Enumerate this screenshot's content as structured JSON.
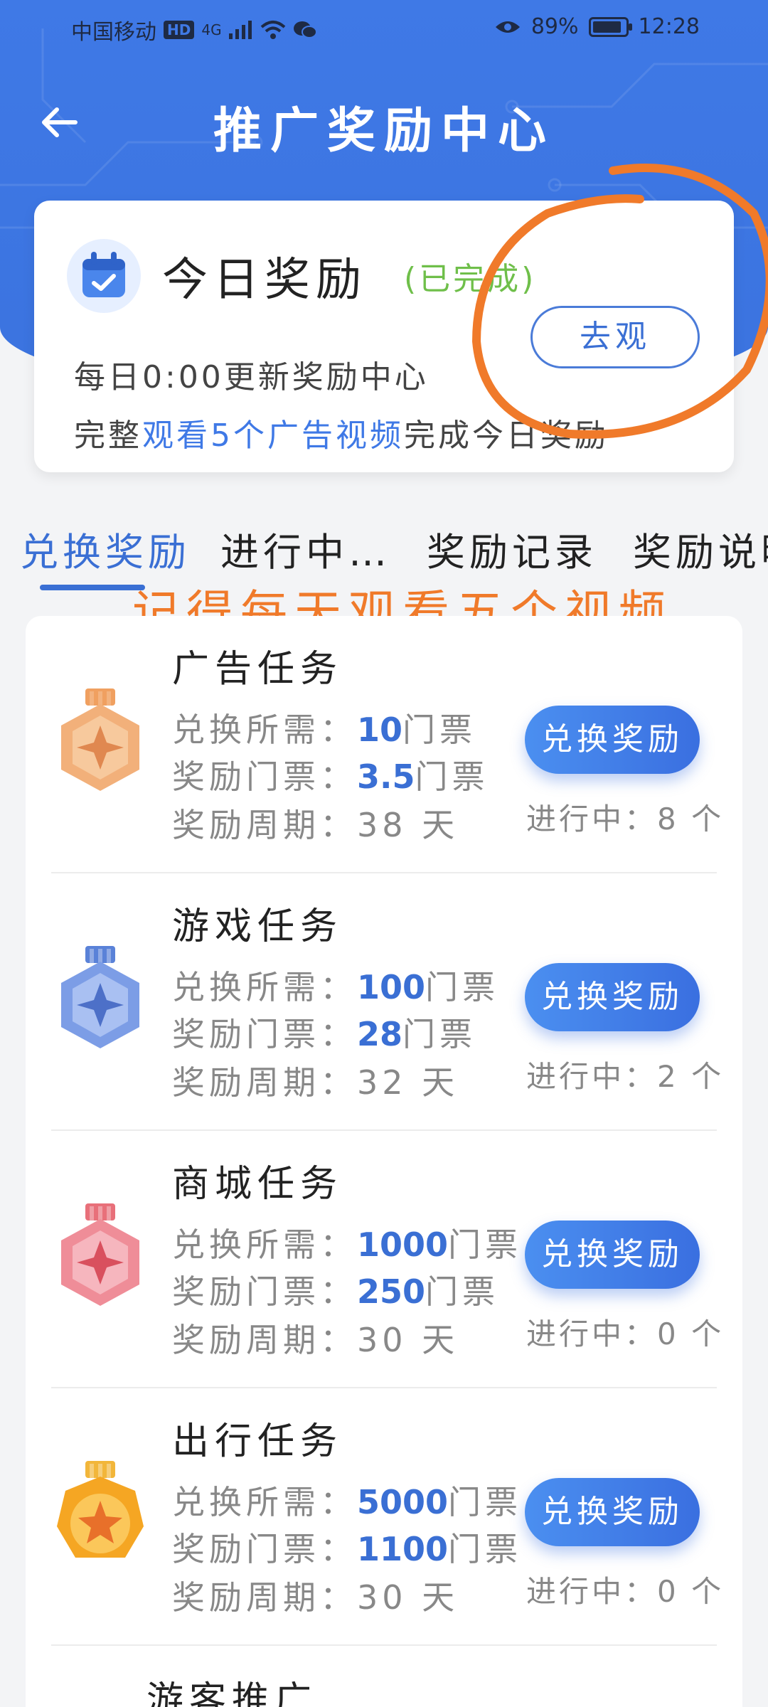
{
  "status_bar": {
    "carrier": "中国移动",
    "hd": "HD",
    "network": "4G",
    "battery_percent": "89%",
    "battery_level": 0.89,
    "time": "12:28"
  },
  "header": {
    "title": "推广奖励中心"
  },
  "today": {
    "title": "今日奖励",
    "status": "(已完成)",
    "go_button": "去观",
    "line1": "每日0:00更新奖励中心",
    "line2_prefix": "完整",
    "line2_highlight": "观看5个广告视频",
    "line2_suffix": "完成今日奖励"
  },
  "tabs": [
    {
      "label": "兑换奖励",
      "active": true
    },
    {
      "label": "进行中…",
      "active": false
    },
    {
      "label": "奖励记录",
      "active": false
    },
    {
      "label": "奖励说明",
      "active": false
    }
  ],
  "annotation": {
    "text": "记得每天观看五个视频",
    "color": "#f07a2a"
  },
  "labels": {
    "cost": "兑换所需：",
    "reward": "奖励门票：",
    "period": "奖励周期：",
    "unit_ticket": "门票",
    "unit_day": "天",
    "redeem": "兑换奖励"
  },
  "tasks": [
    {
      "title": "广告任务",
      "cost": "10",
      "reward": "3.5",
      "period": "38",
      "progress": "进行中：8 个",
      "medal": "bronze-medal-icon"
    },
    {
      "title": "游戏任务",
      "cost": "100",
      "reward": "28",
      "period": "32",
      "progress": "进行中：2 个",
      "medal": "blue-medal-icon"
    },
    {
      "title": "商城任务",
      "cost": "1000",
      "reward": "250",
      "period": "30",
      "progress": "进行中：0 个",
      "medal": "pink-medal-icon"
    },
    {
      "title": "出行任务",
      "cost": "5000",
      "reward": "1100",
      "period": "30",
      "progress": "进行中：0 个",
      "medal": "gold-medal-icon"
    }
  ],
  "partial_task": {
    "title": "游客推广"
  },
  "colors": {
    "primary": "#3a6fd4",
    "hero": "#3f79e6",
    "success": "#6fbf4a",
    "annotation": "#f07a2a"
  }
}
